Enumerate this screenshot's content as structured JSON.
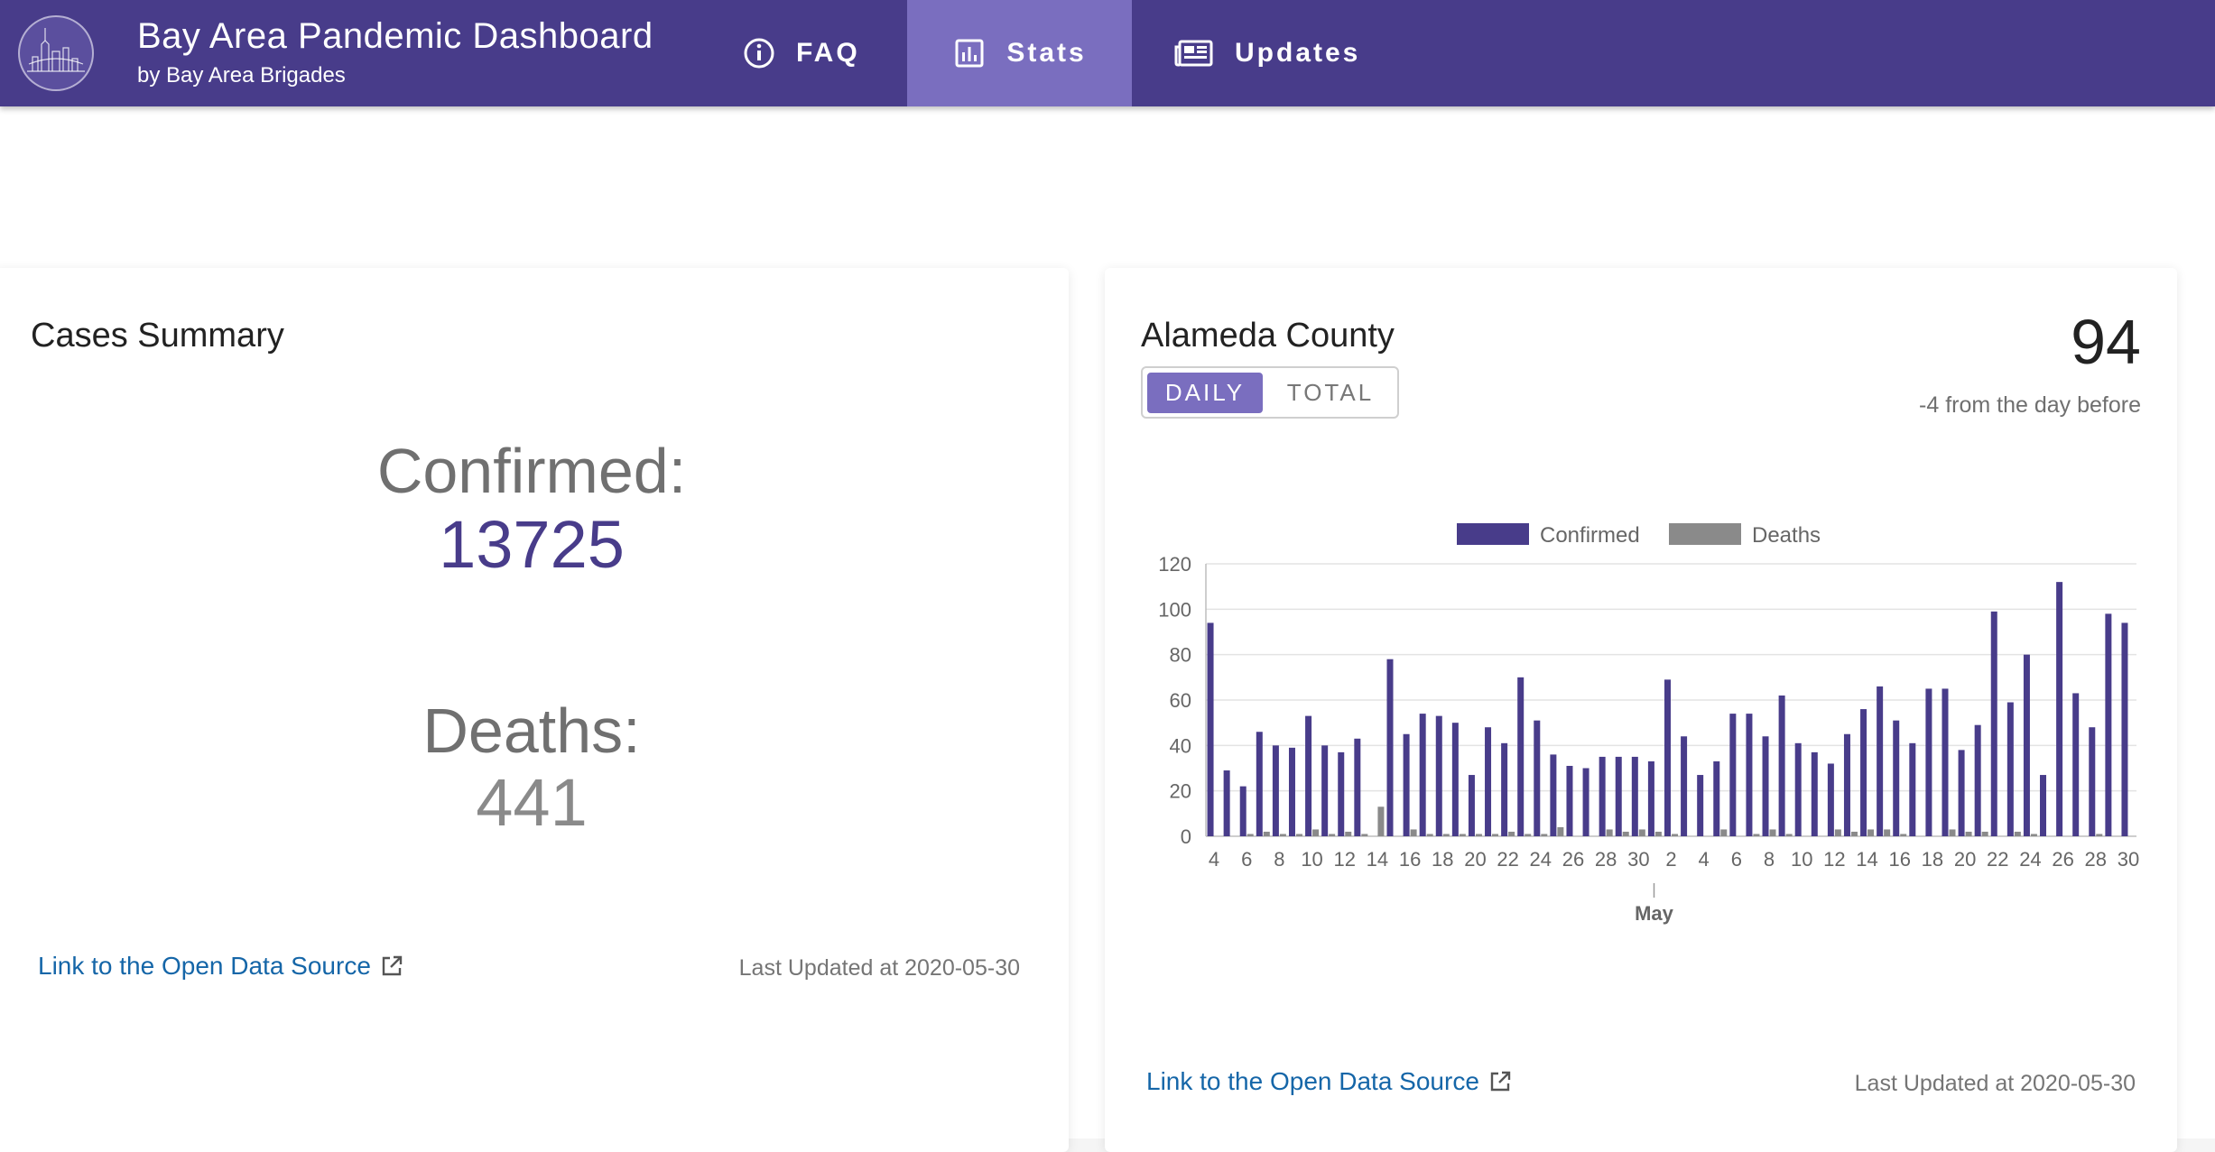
{
  "header": {
    "title": "Bay Area Pandemic Dashboard",
    "subtitle": "by Bay Area Brigades",
    "nav": [
      {
        "label": "FAQ",
        "icon": "info-circle-icon"
      },
      {
        "label": "Stats",
        "icon": "bar-chart-icon",
        "active": true
      },
      {
        "label": "Updates",
        "icon": "newspaper-icon"
      }
    ]
  },
  "summary": {
    "title": "Cases Summary",
    "confirmed_label": "Confirmed:",
    "confirmed_value": "13725",
    "deaths_label": "Deaths:",
    "deaths_value": "441",
    "link_label": "Link to the Open Data Source",
    "updated": "Last Updated at 2020-05-30"
  },
  "county": {
    "title": "Alameda County",
    "toggle": [
      "DAILY",
      "TOTAL"
    ],
    "selected": "DAILY",
    "value": "94",
    "delta": "-4 from the day before",
    "link_label": "Link to the Open Data Source",
    "updated": "Last Updated at 2020-05-30"
  },
  "colors": {
    "brand": "#483c8a",
    "active_tab": "#7a6ebf",
    "confirmed": "#483c8a",
    "deaths": "#8a8a8a",
    "link": "#1566a8"
  },
  "chart_data": {
    "type": "bar",
    "legend": [
      "Confirmed",
      "Deaths"
    ],
    "legend_position": "top",
    "ylim": [
      0,
      120
    ],
    "yticks": [
      0,
      20,
      40,
      60,
      80,
      100,
      120
    ],
    "grid": true,
    "x_tick_labels": [
      "4",
      "6",
      "8",
      "10",
      "12",
      "14",
      "16",
      "18",
      "20",
      "22",
      "24",
      "26",
      "28",
      "30",
      "2",
      "4",
      "6",
      "8",
      "10",
      "12",
      "14",
      "16",
      "18",
      "20",
      "22",
      "24",
      "26",
      "28",
      "30"
    ],
    "x_major_label": "May",
    "series": [
      {
        "name": "Confirmed",
        "values": [
          94,
          29,
          22,
          46,
          40,
          39,
          53,
          40,
          37,
          43,
          0,
          78,
          45,
          54,
          53,
          50,
          27,
          48,
          41,
          70,
          51,
          36,
          31,
          30,
          35,
          35,
          35,
          33,
          69,
          44,
          27,
          33,
          54,
          54,
          44,
          62,
          41,
          37,
          32,
          45,
          56,
          66,
          51,
          41,
          65,
          65,
          38,
          49,
          99,
          59,
          80,
          27,
          112,
          63,
          48,
          98,
          94
        ]
      },
      {
        "name": "Deaths",
        "values": [
          0,
          0,
          1,
          2,
          1,
          1,
          3,
          1,
          2,
          1,
          13,
          0,
          3,
          1,
          1,
          1,
          1,
          1,
          2,
          1,
          1,
          4,
          0,
          0,
          3,
          2,
          3,
          2,
          1,
          0,
          0,
          3,
          0,
          1,
          3,
          1,
          0,
          0,
          3,
          2,
          3,
          3,
          1,
          0,
          0,
          3,
          2,
          2,
          0,
          2,
          1,
          0,
          0,
          0,
          1,
          0,
          0
        ]
      }
    ]
  }
}
